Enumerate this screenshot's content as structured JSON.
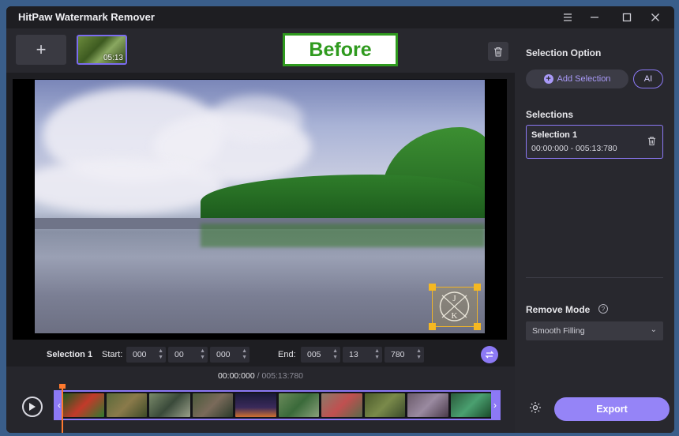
{
  "window": {
    "title": "HitPaw Watermark Remover",
    "controls": [
      "menu-icon",
      "minimize-icon",
      "maximize-icon",
      "close-icon"
    ]
  },
  "toolbar": {
    "add_symbol": "+",
    "thumbnail_duration": "05:13",
    "before_label": "Before"
  },
  "selection_bar": {
    "name": "Selection 1",
    "start_label": "Start:",
    "start": {
      "h": "000",
      "m": "00",
      "ms": "000"
    },
    "end_label": "End:",
    "end": {
      "h": "005",
      "m": "13",
      "ms": "780"
    }
  },
  "timeline": {
    "current": "00:00:000",
    "separator": " / ",
    "total": "005:13:780"
  },
  "panel": {
    "selection_option_title": "Selection Option",
    "add_selection_label": "Add Selection",
    "ai_label": "AI",
    "selections_title": "Selections",
    "selection_card": {
      "name": "Selection 1",
      "range": "00:00:000 - 005:13:780"
    },
    "remove_mode_title": "Remove Mode",
    "remove_mode_value": "Smooth Filling",
    "export_label": "Export"
  },
  "watermark_letters": {
    "top": "J",
    "bottom": "K"
  },
  "colors": {
    "accent": "#8c79f5",
    "before_green": "#2f9a1e",
    "handle": "#f5b822",
    "playhead": "#ff7a2e"
  }
}
